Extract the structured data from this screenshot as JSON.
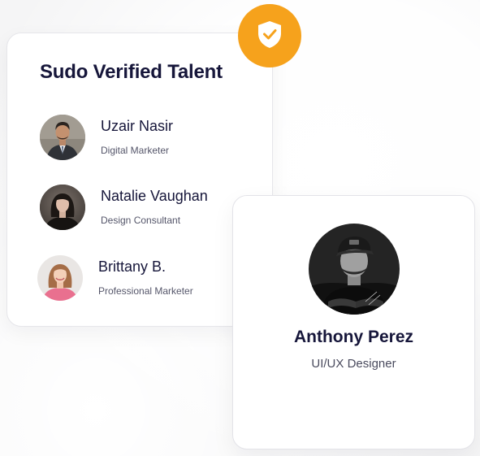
{
  "talent_card": {
    "title": "Sudo Verified Talent",
    "members": [
      {
        "name": "Uzair Nasir",
        "role": "Digital Marketer",
        "avatar_icon": "avatar-man-suit-icon"
      },
      {
        "name": "Natalie Vaughan",
        "role": "Design Consultant",
        "avatar_icon": "avatar-woman-dark-hair-icon"
      },
      {
        "name": "Brittany B.",
        "role": "Professional Marketer",
        "avatar_icon": "avatar-woman-pink-top-icon"
      }
    ]
  },
  "badge": {
    "icon": "shield-check-icon",
    "color": "#f6a21c"
  },
  "featured_profile": {
    "name": "Anthony Perez",
    "role": "UI/UX Designer",
    "avatar_icon": "avatar-man-cap-monochrome-icon"
  },
  "colors": {
    "heading": "#16163a",
    "subtext": "#55566a",
    "accent": "#f6a21c",
    "card_border": "#e6e6ea"
  }
}
